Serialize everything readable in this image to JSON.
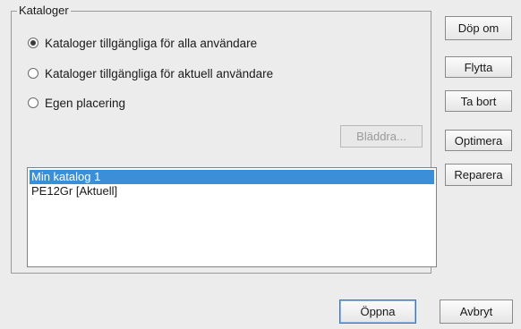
{
  "group": {
    "legend": "Kataloger"
  },
  "radios": [
    {
      "label": "Kataloger tillgängliga för alla användare",
      "checked": true
    },
    {
      "label": "Kataloger tillgängliga för aktuell användare",
      "checked": false
    },
    {
      "label": "Egen placering",
      "checked": false
    }
  ],
  "browse_button": "Bläddra...",
  "catalogs": [
    {
      "name": "Min katalog 1",
      "selected": true
    },
    {
      "name": "PE12Gr [Aktuell]",
      "selected": false
    }
  ],
  "side_buttons": {
    "rename": "Döp om",
    "move": "Flytta",
    "remove": "Ta bort",
    "optimize": "Optimera",
    "repair": "Reparera"
  },
  "footer": {
    "open": "Öppna",
    "cancel": "Avbryt"
  }
}
